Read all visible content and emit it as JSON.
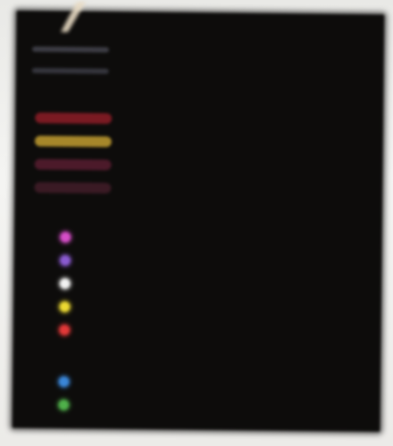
{
  "legend": {
    "title": "",
    "items_top": [
      {
        "label": ""
      },
      {
        "label": ""
      }
    ],
    "group1": {
      "header": "",
      "items": [
        {
          "label": "",
          "color": "#7a1a22"
        },
        {
          "label": "",
          "color": "#a6872a"
        },
        {
          "label": "",
          "color": "#4c1a2a"
        },
        {
          "label": "",
          "color": "#3a1a24"
        }
      ]
    },
    "group2": {
      "header": "",
      "items": [
        {
          "label": "",
          "color": "#d64ec8"
        },
        {
          "label": "",
          "color": "#8a5ad0"
        },
        {
          "label": "",
          "color": "#f2f2f2"
        },
        {
          "label": "",
          "color": "#ecd932"
        },
        {
          "label": "",
          "color": "#e23838"
        }
      ]
    },
    "group3": {
      "header": "",
      "items": [
        {
          "label": "",
          "color": "#3a86d8"
        },
        {
          "label": "",
          "color": "#4fb04a"
        }
      ]
    }
  }
}
